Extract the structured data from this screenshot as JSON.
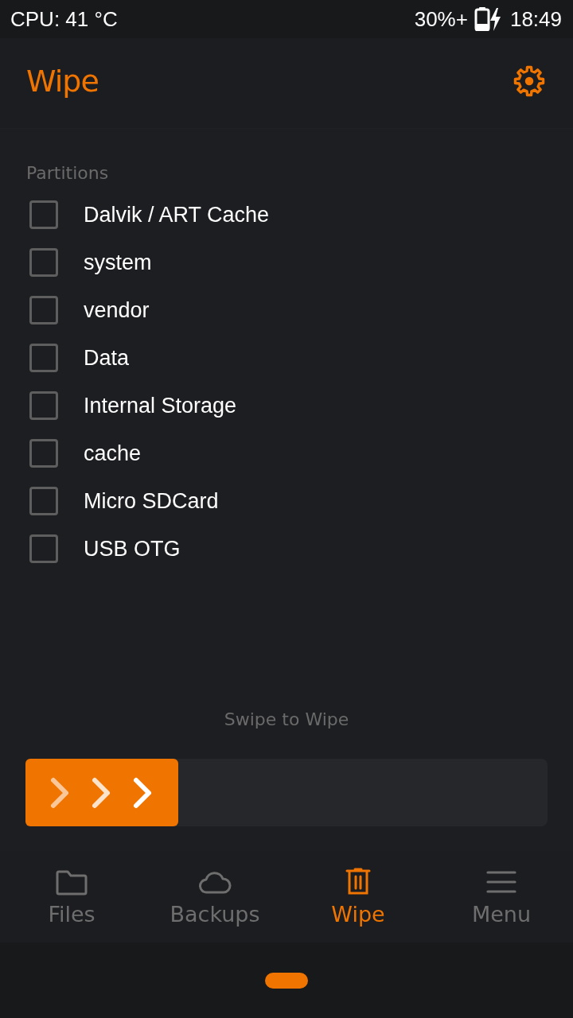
{
  "status_bar": {
    "cpu": "CPU: 41 °C",
    "battery": "30%+",
    "time": "18:49"
  },
  "app_bar": {
    "title": "Wipe"
  },
  "partitions": {
    "heading": "Partitions",
    "items": [
      {
        "label": "Dalvik / ART Cache",
        "checked": false
      },
      {
        "label": "system",
        "checked": false
      },
      {
        "label": "vendor",
        "checked": false
      },
      {
        "label": "Data",
        "checked": false
      },
      {
        "label": "Internal Storage",
        "checked": false
      },
      {
        "label": "cache",
        "checked": false
      },
      {
        "label": "Micro SDCard",
        "checked": false
      },
      {
        "label": "USB OTG",
        "checked": false
      }
    ]
  },
  "swipe": {
    "label": "Swipe to Wipe"
  },
  "nav": [
    {
      "label": "Files",
      "kind": "files",
      "selected": false
    },
    {
      "label": "Backups",
      "kind": "backups",
      "selected": false
    },
    {
      "label": "Wipe",
      "kind": "wipe",
      "selected": true
    },
    {
      "label": "Menu",
      "kind": "menu",
      "selected": false
    }
  ]
}
